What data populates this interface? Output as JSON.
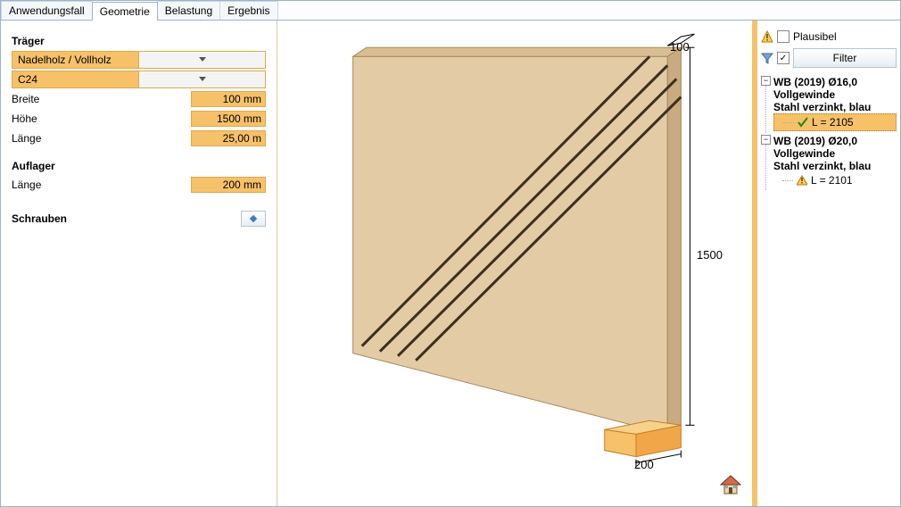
{
  "tabs": {
    "t0": "Anwendungsfall",
    "t1": "Geometrie",
    "t2": "Belastung",
    "t3": "Ergebnis",
    "active": 1
  },
  "left": {
    "traeger": {
      "title": "Träger",
      "material": "Nadelholz / Vollholz",
      "class": "C24",
      "breite_lbl": "Breite",
      "breite_val": "100 mm",
      "hoehe_lbl": "Höhe",
      "hoehe_val": "1500 mm",
      "laenge_lbl": "Länge",
      "laenge_val": "25,00 m"
    },
    "auflager": {
      "title": "Auflager",
      "laenge_lbl": "Länge",
      "laenge_val": "200 mm"
    },
    "schrauben": {
      "title": "Schrauben"
    }
  },
  "view": {
    "dim_top": "100",
    "dim_side": "1500",
    "dim_bottom": "200"
  },
  "right": {
    "plausibel": "Plausibel",
    "filter": "Filter",
    "items": [
      {
        "head1": "WB (2019) Ø16,0",
        "head2": "Vollgewinde",
        "head3": "Stahl verzinkt, blau",
        "leaf": "L = 2105",
        "leaf_ok": true,
        "selected": true
      },
      {
        "head1": "WB (2019) Ø20,0",
        "head2": "Vollgewinde",
        "head3": "Stahl verzinkt, blau",
        "leaf": "L = 2101",
        "leaf_ok": false,
        "selected": false
      }
    ]
  }
}
